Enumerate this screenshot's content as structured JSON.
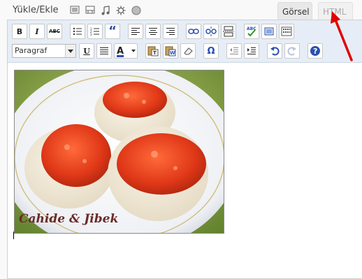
{
  "header": {
    "upload_label": "Yükle/Ekle",
    "media_icons": [
      "image-icon",
      "video-icon",
      "music-icon",
      "media-gear-icon",
      "circle-icon"
    ]
  },
  "tabs": [
    {
      "label": "Görsel",
      "state": "active"
    },
    {
      "label": "HTML",
      "state": "inactive"
    }
  ],
  "toolbar": {
    "row1": [
      {
        "name": "bold",
        "glyph": "B"
      },
      {
        "name": "italic",
        "glyph": "I"
      },
      {
        "name": "strikethrough",
        "glyph": "ABC"
      },
      {
        "name": "bullet-list"
      },
      {
        "name": "numbered-list"
      },
      {
        "name": "blockquote",
        "glyph": "“"
      },
      {
        "name": "align-left"
      },
      {
        "name": "align-center"
      },
      {
        "name": "align-right"
      },
      {
        "name": "insert-link"
      },
      {
        "name": "unlink"
      },
      {
        "name": "insert-more"
      },
      {
        "name": "spellcheck"
      },
      {
        "name": "fullscreen"
      },
      {
        "name": "kitchen-sink"
      }
    ],
    "format_select_value": "Paragraf",
    "row2": [
      {
        "name": "underline",
        "glyph": "U"
      },
      {
        "name": "justify"
      },
      {
        "name": "text-color",
        "glyph": "A"
      },
      {
        "name": "paste-text"
      },
      {
        "name": "paste-word"
      },
      {
        "name": "remove-format"
      },
      {
        "name": "special-char",
        "glyph": "Ω"
      },
      {
        "name": "outdent"
      },
      {
        "name": "indent"
      },
      {
        "name": "undo"
      },
      {
        "name": "redo"
      },
      {
        "name": "help",
        "glyph": "?"
      }
    ]
  },
  "content": {
    "photo_caption": "Cahide & Jibek"
  },
  "colors": {
    "annotation_arrow": "#e00000",
    "toolbar_bg": "#e6edf6",
    "text_color_bar": "#2a4fb0"
  }
}
